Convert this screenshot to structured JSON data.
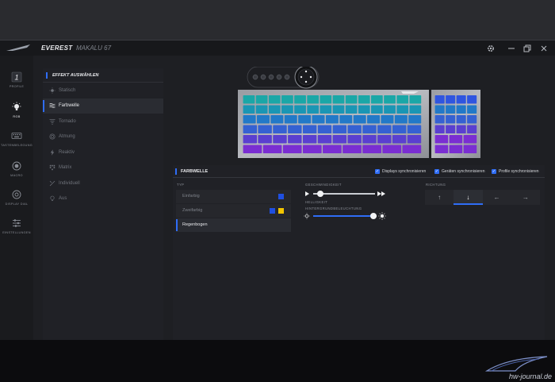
{
  "titlebar": {
    "app_title": "EVEREST",
    "device_name": "MAKALU 67"
  },
  "rail": {
    "items": [
      {
        "label": "PROFILE",
        "icon": "profile-1-icon"
      },
      {
        "label": "RGB",
        "icon": "bulb-icon"
      },
      {
        "label": "TASTENBELEGUNG",
        "icon": "keyboard-icon"
      },
      {
        "label": "MACRO",
        "icon": "macro-record-icon"
      },
      {
        "label": "DISPLAY DIAL",
        "icon": "dial-icon"
      },
      {
        "label": "EINSTELLUNGEN",
        "icon": "sliders-icon"
      }
    ]
  },
  "effects": {
    "header": "EFFEKT AUSWÄHLEN",
    "items": [
      {
        "label": "Statisch",
        "icon": "sun-icon"
      },
      {
        "label": "Farbwelle",
        "icon": "wave-icon"
      },
      {
        "label": "Tornado",
        "icon": "tornado-icon"
      },
      {
        "label": "Atmung",
        "icon": "breathing-icon"
      },
      {
        "label": "Reaktiv",
        "icon": "lightning-icon"
      },
      {
        "label": "Matrix",
        "icon": "matrix-icon"
      },
      {
        "label": "Individuell",
        "icon": "custom-icon"
      },
      {
        "label": "Aus",
        "icon": "bulb-off-icon"
      }
    ],
    "selected": "Farbwelle"
  },
  "panel": {
    "title": "FARBWELLE",
    "checkboxes": [
      {
        "label": "Displays synchronisieren",
        "checked": true
      },
      {
        "label": "Geräten synchronisieren",
        "checked": true
      },
      {
        "label": "Profile synchronisieren",
        "checked": true
      }
    ],
    "typ_label": "TYP",
    "typ_items": [
      {
        "label": "Einfarbig",
        "swatches": [
          "#1f4fe0"
        ]
      },
      {
        "label": "Zweifarbig",
        "swatches": [
          "#1f4fe0",
          "#f2c400"
        ]
      },
      {
        "label": "Regenbogen",
        "swatches": []
      }
    ],
    "typ_selected": "Regenbogen",
    "speed_label": "GESCHWINDIGKEIT",
    "speed_value": 0.12,
    "brightness_label": "HELLIGKEIT",
    "backlight_label": "HINTERGRUNDBELEUCHTUNG",
    "backlight_value": 0.95,
    "direction_label": "RICHTUNG",
    "directions": [
      "↑",
      "↓",
      "←",
      "→"
    ],
    "direction_selected": "↓"
  },
  "watermark": "hw-journal.de",
  "colors": {
    "accent": "#2f6df6",
    "bg": "#1e1f23",
    "panel": "#202126"
  }
}
